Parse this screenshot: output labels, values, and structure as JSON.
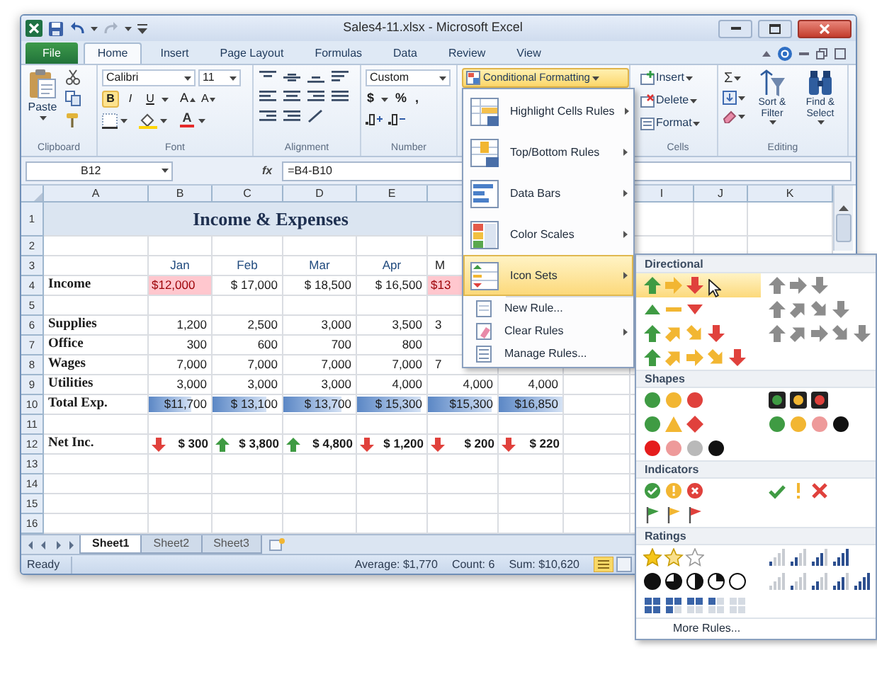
{
  "window": {
    "title": "Sales4-11.xlsx - Microsoft Excel"
  },
  "ribbon_tabs": [
    {
      "label": "File",
      "selected": false,
      "kind": "backstage"
    },
    {
      "label": "Home",
      "selected": true,
      "kind": "tab"
    },
    {
      "label": "Insert",
      "selected": false,
      "kind": "tab"
    },
    {
      "label": "Page Layout",
      "selected": false,
      "kind": "tab"
    },
    {
      "label": "Formulas",
      "selected": false,
      "kind": "tab"
    },
    {
      "label": "Data",
      "selected": false,
      "kind": "tab"
    },
    {
      "label": "Review",
      "selected": false,
      "kind": "tab"
    },
    {
      "label": "View",
      "selected": false,
      "kind": "tab"
    }
  ],
  "ribbon": {
    "clipboard": {
      "paste": "Paste",
      "group": "Clipboard"
    },
    "font": {
      "name": "Calibri",
      "size": "11",
      "styles": [
        {
          "label": "B",
          "on": true
        },
        {
          "label": "I",
          "on": false
        },
        {
          "label": "U",
          "on": false
        }
      ],
      "grow": "A",
      "shrink": "A",
      "font_color": "A",
      "group": "Font"
    },
    "alignment": {
      "group": "Alignment"
    },
    "number": {
      "format": "Custom",
      "symbols": [
        "$",
        "%",
        ","
      ],
      "group": "Number"
    },
    "styles": {
      "conditional_formatting": {
        "label": "Conditional Formatting",
        "open": true
      }
    },
    "cells": {
      "buttons": [
        "Insert",
        "Delete",
        "Format"
      ],
      "group": "Cells"
    },
    "editing": {
      "autosum": "Σ",
      "sort": "Sort & Filter",
      "find": "Find & Select",
      "group": "Editing"
    }
  },
  "formula_bar": {
    "name_box": "B12",
    "fx": "fx",
    "formula": "=B4-B10"
  },
  "columns": [
    "A",
    "B",
    "C",
    "D",
    "E",
    null,
    null,
    null,
    "I",
    "J",
    "K"
  ],
  "rows": [
    {
      "number": "1",
      "cells": [
        {
          "text": "Income & Expenses",
          "kind": "title"
        }
      ]
    },
    {
      "number": "2"
    },
    {
      "number": "3",
      "cells": [
        null,
        {
          "text": "Jan",
          "kind": "month"
        },
        {
          "text": "Feb",
          "kind": "month"
        },
        {
          "text": "Mar",
          "kind": "month"
        },
        {
          "text": "Apr",
          "kind": "month"
        },
        {
          "text": "M",
          "kind": "partial"
        }
      ]
    },
    {
      "number": "4",
      "cells": [
        {
          "text": "Income",
          "kind": "label"
        },
        {
          "text": "$12,000",
          "kind": "highlight"
        },
        {
          "text": "$ 17,000",
          "kind": "amount"
        },
        {
          "text": "$ 18,500",
          "kind": "amount"
        },
        {
          "text": "$ 16,500",
          "kind": "amount"
        },
        {
          "text": "$13",
          "kind": "highlight"
        }
      ]
    },
    {
      "number": "5"
    },
    {
      "number": "6",
      "cells": [
        {
          "text": "Supplies",
          "kind": "label"
        },
        {
          "text": "1,200",
          "kind": "amount"
        },
        {
          "text": "2,500",
          "kind": "amount"
        },
        {
          "text": "3,000",
          "kind": "amount"
        },
        {
          "text": "3,500",
          "kind": "amount"
        },
        {
          "text": "3",
          "kind": "partial"
        }
      ]
    },
    {
      "number": "7",
      "cells": [
        {
          "text": "Office",
          "kind": "label"
        },
        {
          "text": "300",
          "kind": "amount"
        },
        {
          "text": "600",
          "kind": "amount"
        },
        {
          "text": "700",
          "kind": "amount"
        },
        {
          "text": "800",
          "kind": "amount"
        }
      ]
    },
    {
      "number": "8",
      "cells": [
        {
          "text": "Wages",
          "kind": "label"
        },
        {
          "text": "7,000",
          "kind": "amount"
        },
        {
          "text": "7,000",
          "kind": "amount"
        },
        {
          "text": "7,000",
          "kind": "amount"
        },
        {
          "text": "7,000",
          "kind": "amount"
        },
        {
          "text": "7",
          "kind": "partial"
        }
      ]
    },
    {
      "number": "9",
      "cells": [
        {
          "text": "Utilities",
          "kind": "label"
        },
        {
          "text": "3,000",
          "kind": "amount"
        },
        {
          "text": "3,000",
          "kind": "amount"
        },
        {
          "text": "3,000",
          "kind": "amount"
        },
        {
          "text": "4,000",
          "kind": "amount"
        },
        {
          "text": "4,000",
          "kind": "amount"
        },
        {
          "text": "4,000",
          "kind": "amount"
        }
      ]
    },
    {
      "number": "10",
      "cells": [
        {
          "text": "Total Exp.",
          "kind": "label"
        },
        {
          "text": "$11,700",
          "kind": "databar",
          "level": 0.69
        },
        {
          "text": "$ 13,100",
          "kind": "databar",
          "level": 0.78
        },
        {
          "text": "$ 13,700",
          "kind": "databar",
          "level": 0.81
        },
        {
          "text": "$ 15,300",
          "kind": "databar",
          "level": 0.91
        },
        {
          "text": "$15,300",
          "kind": "databar",
          "level": 0.91
        },
        {
          "text": "$16,850",
          "kind": "databar",
          "level": 1
        }
      ]
    },
    {
      "number": "11"
    },
    {
      "number": "12",
      "cells": [
        {
          "text": "Net Inc.",
          "kind": "label"
        },
        {
          "text": "$ 300",
          "kind": "down"
        },
        {
          "text": "$ 3,800",
          "kind": "up"
        },
        {
          "text": "$ 4,800",
          "kind": "up"
        },
        {
          "text": "$ 1,200",
          "kind": "down"
        },
        {
          "text": "$ 200",
          "kind": "down"
        },
        {
          "text": "$ 220",
          "kind": "down"
        }
      ]
    },
    {
      "number": "13"
    },
    {
      "number": "14"
    },
    {
      "number": "15"
    },
    {
      "number": "16"
    }
  ],
  "sheet_tabs": [
    {
      "label": "Sheet1",
      "selected": true
    },
    {
      "label": "Sheet2",
      "selected": false
    },
    {
      "label": "Sheet3",
      "selected": false
    }
  ],
  "status_bar": {
    "mode": "Ready",
    "average": "Average: $1,770",
    "count": "Count: 6",
    "sum": "Sum: $10,620"
  },
  "menu": {
    "items": [
      {
        "label": "Highlight Cells Rules",
        "kind": "large",
        "submenu": true,
        "selected": false
      },
      {
        "label": "Top/Bottom Rules",
        "kind": "large",
        "submenu": true,
        "selected": false
      },
      {
        "label": "Data Bars",
        "kind": "large",
        "submenu": true,
        "selected": false
      },
      {
        "label": "Color Scales",
        "kind": "large",
        "submenu": true,
        "selected": false
      },
      {
        "label": "Icon Sets",
        "kind": "large",
        "submenu": true,
        "selected": true
      },
      {
        "label": "New Rule...",
        "kind": "small",
        "submenu": false,
        "selected": false
      },
      {
        "label": "Clear Rules",
        "kind": "small",
        "submenu": true,
        "selected": false
      },
      {
        "label": "Manage Rules...",
        "kind": "small",
        "submenu": false,
        "selected": false
      }
    ]
  },
  "icon_sets": {
    "sections": [
      {
        "title": "Directional",
        "sets": [
          {
            "kind": "arrows3",
            "selected": true
          },
          {
            "kind": "arrows3gray",
            "selected": false
          },
          {
            "kind": "triangles3",
            "selected": false
          },
          {
            "kind": "arrows4gray",
            "selected": false
          },
          {
            "kind": "arrows4",
            "selected": false
          },
          {
            "kind": "arrows5gray",
            "selected": false
          },
          {
            "kind": "arrows5",
            "selected": false
          }
        ]
      },
      {
        "title": "Shapes",
        "sets": [
          {
            "kind": "circles3",
            "selected": false
          },
          {
            "kind": "lights3",
            "selected": false
          },
          {
            "kind": "signs3",
            "selected": false
          },
          {
            "kind": "lights4",
            "selected": false
          },
          {
            "kind": "redtoblack",
            "selected": false
          }
        ]
      },
      {
        "title": "Indicators",
        "sets": [
          {
            "kind": "symbols3circled",
            "selected": false
          },
          {
            "kind": "symbols3",
            "selected": false
          },
          {
            "kind": "flags3",
            "selected": false
          }
        ]
      },
      {
        "title": "Ratings",
        "sets": [
          {
            "kind": "stars3",
            "selected": false
          },
          {
            "kind": "bars4",
            "selected": false
          },
          {
            "kind": "quarters5",
            "selected": false
          },
          {
            "kind": "bars5",
            "selected": false
          },
          {
            "kind": "boxes5",
            "selected": false
          }
        ]
      }
    ],
    "more": "More Rules..."
  }
}
